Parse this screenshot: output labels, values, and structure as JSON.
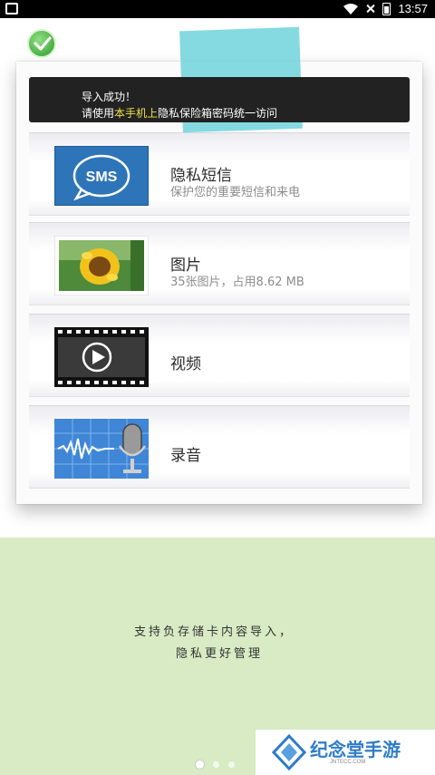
{
  "status_bar": {
    "time": "13:57"
  },
  "banner": {
    "line1": "导入成功！",
    "line2_prefix": "请使用",
    "line2_highlight": "本手机上",
    "line2_suffix": "隐私保险箱密码统一访问"
  },
  "items": [
    {
      "title": "隐私短信",
      "subtitle": "保护您的重要短信和来电",
      "icon": "sms-icon",
      "icon_text": "SMS"
    },
    {
      "title": "图片",
      "subtitle": "35张图片，占用8.62 MB",
      "icon": "photo-icon"
    },
    {
      "title": "视频",
      "icon": "video-icon"
    },
    {
      "title": "录音",
      "icon": "microphone-icon"
    }
  ],
  "note": {
    "line1": "支持负存储卡内容导入，",
    "line2": "隐私更好管理"
  },
  "pager": {
    "count": 3,
    "active": 0
  },
  "watermark": {
    "title": "纪念堂手游",
    "sub": "JNTECC.COM"
  },
  "colors": {
    "tape": "#6fd3db",
    "green_area": "#d8ebc4",
    "highlight": "#f4e14a",
    "watermark_blue": "#2e7cc8"
  }
}
